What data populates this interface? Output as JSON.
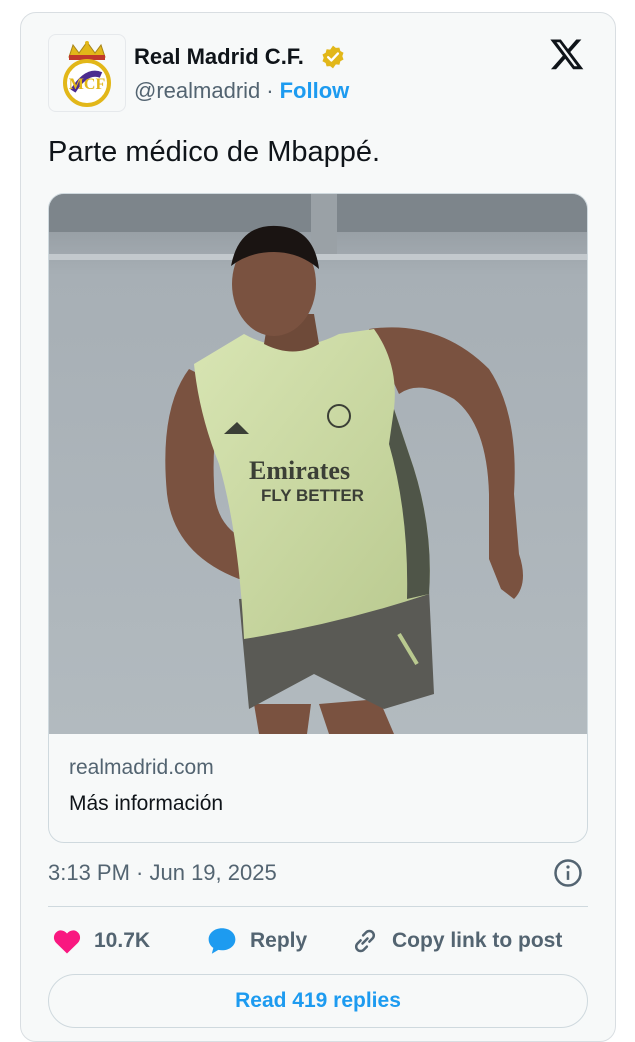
{
  "author": {
    "name": "Real Madrid C.F.",
    "handle": "@realmadrid",
    "separator": "·",
    "follow_label": "Follow"
  },
  "tweet": {
    "text": "Parte médico de Mbappé."
  },
  "link_card": {
    "domain": "realmadrid.com",
    "title": "Más información"
  },
  "meta": {
    "timestamp": "3:13 PM · Jun 19, 2025"
  },
  "actions": {
    "likes": "10.7K",
    "reply_label": "Reply",
    "copy_label": "Copy link to post"
  },
  "footer": {
    "read_replies_label": "Read 419 replies"
  },
  "icons": [
    "real-madrid-crest-icon",
    "verified-badge-icon",
    "x-logo-icon",
    "info-icon",
    "heart-icon",
    "reply-bubble-icon",
    "link-icon"
  ],
  "colors": {
    "accent": "#1d9bf0",
    "like": "#f91880",
    "verified_gold": "#e2b719",
    "text_primary": "#0f1419",
    "text_secondary": "#536471"
  }
}
